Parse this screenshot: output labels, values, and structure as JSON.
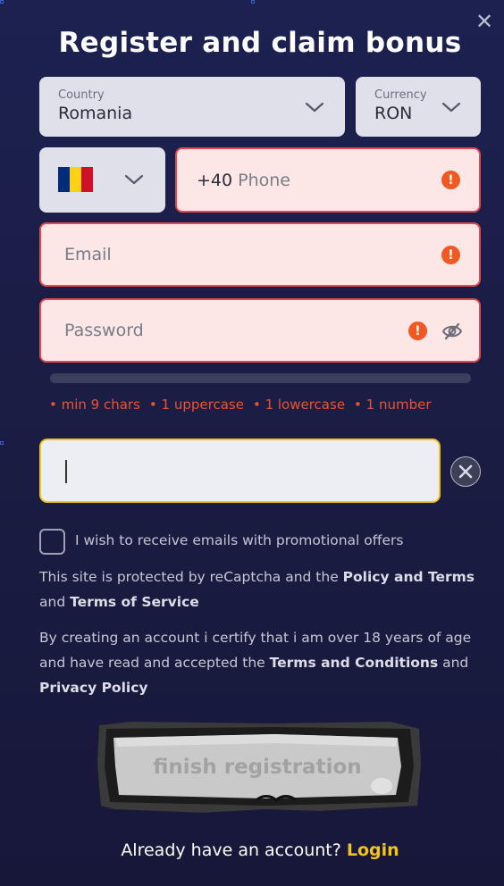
{
  "header": {
    "title": "Register and claim bonus",
    "close_symbol": "✕"
  },
  "country": {
    "label": "Country",
    "value": "Romania"
  },
  "currency": {
    "label": "Currency",
    "value": "RON"
  },
  "phone": {
    "flag_colors": [
      "#002b7f",
      "#fcd116",
      "#ce1126"
    ],
    "prefix": "+40",
    "placeholder": "Phone"
  },
  "email": {
    "placeholder": "Email"
  },
  "password": {
    "placeholder": "Password"
  },
  "password_rules": [
    "• min 9 chars",
    "• 1 uppercase",
    "• 1 lowercase",
    "• 1 number"
  ],
  "captcha_input": {
    "value": ""
  },
  "promo_checkbox": {
    "label": "I wish to receive emails with promotional offers",
    "checked": false
  },
  "recaptcha_notice": {
    "text1": "This site is protected by reCaptcha and the ",
    "link1": "Policy and Terms",
    "text2": " and ",
    "link2": "Terms of Service"
  },
  "age_notice": {
    "text1": "By creating an account i certify that i am over 18 years of age and have read and accepted the ",
    "link1": "Terms and Conditions",
    "text2": " and ",
    "link2": "Privacy Policy"
  },
  "submit_button": {
    "label": "finish registration"
  },
  "footer": {
    "text": "Already have an account?",
    "link": "Login"
  },
  "colors": {
    "accent_yellow": "#f2c21d",
    "error_red": "#e5484d",
    "warning_orange": "#f05a22"
  }
}
